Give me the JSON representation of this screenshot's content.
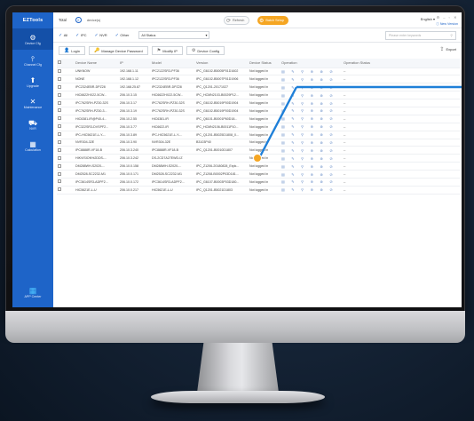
{
  "app": {
    "logo_text": "EZTools",
    "total_label": "Total",
    "total_count": "0",
    "device_label": "device(s)",
    "refresh_label": "Refresh",
    "batch_label": "Batch Setup",
    "language": "English",
    "language_arrow": "▾",
    "window_controls": "⚙ – ▫ ✕",
    "new_version": "New Version"
  },
  "sidebar": {
    "items": [
      {
        "label": "Device Cfg",
        "icon": "⚙"
      },
      {
        "label": "Channel Cfg",
        "icon": "⫯"
      },
      {
        "label": "Upgrade",
        "icon": "⬆"
      },
      {
        "label": "Maintenance",
        "icon": "✕"
      },
      {
        "label": "NVR",
        "icon": "⛟"
      },
      {
        "label": "Calculation",
        "icon": "▦"
      }
    ],
    "app_center": {
      "label": "APP Center",
      "icon": "▦"
    }
  },
  "filters": {
    "tick": "✓",
    "checkboxes": [
      "All",
      "IPC",
      "NVR",
      "Other"
    ],
    "status_value": "All Status",
    "status_arrow": "▾",
    "search_placeholder": "Please enter keywords",
    "search_icon": "⚲"
  },
  "actions": {
    "login": "Login",
    "manage_password": "Manage Device Password",
    "modify_ip": "Modify IP",
    "device_config": "Device Config",
    "export": "Export",
    "icons": {
      "login": "👤",
      "password": "🔑",
      "ip": "⚑",
      "config": "⚙",
      "export": "⇪"
    }
  },
  "table": {
    "headers": [
      "Device Name",
      "IP",
      "Model",
      "Version",
      "Device Status",
      "Operation",
      "Operation Status"
    ],
    "operation_icons": "▤ ✎ ⚲ ⊕ ⊗ ⊘",
    "status_dash": "--",
    "rows": [
      [
        "UNKNOW",
        "192.168.1.11",
        "IPC2122SR3-PF36",
        "IPC_G6102-B5005P01D1602",
        "Not logged in"
      ],
      [
        "NONE",
        "192.168.1.12",
        "IPC2122SR3-PF36",
        "IPC_G6102-B5007P01D1906",
        "Not logged in"
      ],
      [
        "IPC2324EBR-DPZ28",
        "192.168.25.87",
        "IPC2324EBR-DPZ28",
        "IPC_Q1201-20171027",
        "Not logged in"
      ],
      [
        "HIC6622HX22-5CW...",
        "206.10.3.15",
        "HIC6622HX22-5CW...",
        "IPC_HCMN2103-B0029P12...",
        "Not logged in"
      ],
      [
        "IPC762SRH-PZ30-32S",
        "206.10.3.17",
        "IPC762SRH-PZ30-32S",
        "IPC_G6102-B5019P00D1904",
        "Not logged in"
      ],
      [
        "IPC762SRH-PZ30-3...",
        "206.10.3.19",
        "IPC762SRH-PZ30-32S",
        "IPC_G6102-B5019P00D1904",
        "Not logged in"
      ],
      [
        "HIC6381-IR@P40-4...",
        "206.10.2.55",
        "HIC6381-IR",
        "IPC_Q6101-B0001P60D18...",
        "Not logged in"
      ],
      [
        "IPC322SR3-DVSPF2...",
        "206.10.3.77",
        "HIC6622-IR",
        "IPC_HCMN2106-B0011P10...",
        "Not logged in"
      ],
      [
        "IPC-HIC5621E-L-Y-...",
        "206.10.3.89",
        "IPC-HIC5621E-L-Y-...",
        "IPC_Q1201-B5025D1808_0...",
        "Not logged in"
      ],
      [
        "NVR304-32E",
        "206.10.3.90",
        "NVR304-32E",
        "B3103P40",
        "Not logged in"
      ],
      [
        "IPC8888R-VF18-B",
        "206.10.3.240",
        "IPC8888R-VF18-B",
        "IPC_Q1201-B0010D1807",
        "Not logged in"
      ],
      [
        "HIKVISION%2DDS-...",
        "206.10.3.242",
        "DS-2CD7A27EWD-IZ",
        "",
        "Not logged in"
      ],
      [
        "DM288WH-S2020-...",
        "206.10.0.158",
        "DM288WH-S2020-...",
        "IPC_Z1206-20180828_Expk...",
        "Not logged in"
      ],
      [
        "DM2528-SC2232-M1",
        "206.10.0.171",
        "DM2528-SC2232-M1",
        "IPC_Z1208-B0002P03D181...",
        "Not logged in"
      ],
      [
        "IPC3614SR3-ADPF2...",
        "206.10.0.172",
        "IPC3614SR3-ADPF2...",
        "IPC_G6107-B0003P03D180...",
        "Not logged in"
      ],
      [
        "HIC5621E-L-U",
        "206.10.0.217",
        "HIC5621E-L-U",
        "IPC_Q1201-B5021D1803",
        "Not logged in"
      ]
    ]
  }
}
